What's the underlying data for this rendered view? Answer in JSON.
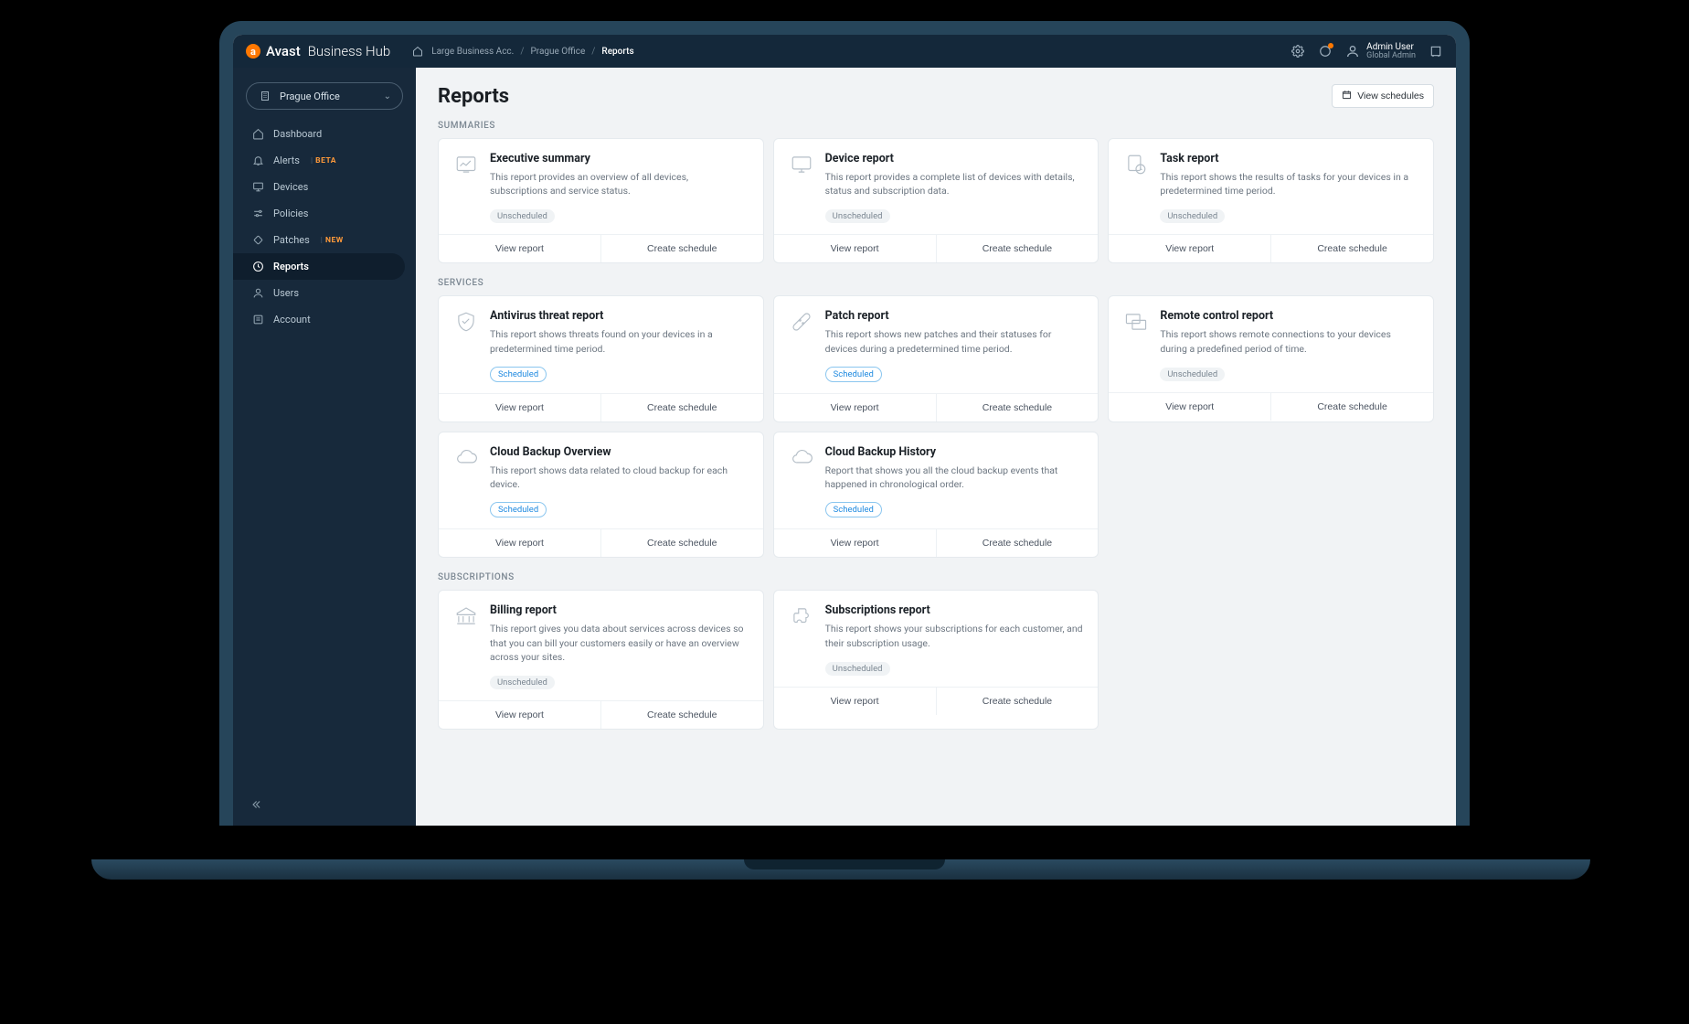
{
  "brand": {
    "name": "Avast",
    "suffix": "Business Hub"
  },
  "breadcrumb": {
    "home_icon": "home",
    "items": [
      "Large Business Acc.",
      "Prague Office"
    ],
    "current": "Reports"
  },
  "topbar": {
    "user_name": "Admin User",
    "user_role": "Global Admin"
  },
  "site_selector": {
    "label": "Prague Office"
  },
  "sidebar": {
    "items": [
      {
        "icon": "home",
        "label": "Dashboard",
        "badge": null
      },
      {
        "icon": "bell",
        "label": "Alerts",
        "badge": "BETA"
      },
      {
        "icon": "monitor",
        "label": "Devices",
        "badge": null
      },
      {
        "icon": "sliders",
        "label": "Policies",
        "badge": null
      },
      {
        "icon": "patch",
        "label": "Patches",
        "badge": "NEW"
      },
      {
        "icon": "clock",
        "label": "Reports",
        "badge": null,
        "active": true
      },
      {
        "icon": "user",
        "label": "Users",
        "badge": null
      },
      {
        "icon": "account",
        "label": "Account",
        "badge": null
      }
    ]
  },
  "page": {
    "title": "Reports",
    "view_schedules_label": "View schedules",
    "action_view": "View report",
    "action_create": "Create schedule",
    "status_unscheduled": "Unscheduled",
    "status_scheduled": "Scheduled"
  },
  "sections": [
    {
      "label": "SUMMARIES",
      "cards": [
        {
          "icon": "chart",
          "title": "Executive summary",
          "desc": "This report provides an overview of all devices, subscriptions and service status.",
          "status": "unscheduled"
        },
        {
          "icon": "monitor",
          "title": "Device report",
          "desc": "This report provides a complete list of devices with details, status and subscription data.",
          "status": "unscheduled"
        },
        {
          "icon": "task",
          "title": "Task report",
          "desc": "This report shows the results of tasks for your devices in a predetermined time period.",
          "status": "unscheduled"
        }
      ]
    },
    {
      "label": "SERVICES",
      "cards": [
        {
          "icon": "shield",
          "title": "Antivirus threat report",
          "desc": "This report shows threats found on your devices in a predetermined time period.",
          "status": "scheduled"
        },
        {
          "icon": "bandage",
          "title": "Patch report",
          "desc": "This report shows new patches and their statuses for devices during a predetermined time period.",
          "status": "scheduled"
        },
        {
          "icon": "remote",
          "title": "Remote control report",
          "desc": "This report shows remote connections to your devices during a predefined period of time.",
          "status": "unscheduled"
        },
        {
          "icon": "cloud",
          "title": "Cloud Backup Overview",
          "desc": "This report shows data related to cloud backup for each device.",
          "status": "scheduled"
        },
        {
          "icon": "cloud",
          "title": "Cloud Backup History",
          "desc": "Report that shows you all the cloud backup events that happened in chronological order.",
          "status": "scheduled"
        }
      ]
    },
    {
      "label": "SUBSCRIPTIONS",
      "cards": [
        {
          "icon": "bank",
          "title": "Billing report",
          "desc": "This report gives you data about services across devices so that you can bill your customers easily or have an overview across your sites.",
          "status": "unscheduled"
        },
        {
          "icon": "puzzle",
          "title": "Subscriptions report",
          "desc": "This report shows your subscriptions for each customer, and their subscription usage.",
          "status": "unscheduled"
        }
      ]
    }
  ]
}
